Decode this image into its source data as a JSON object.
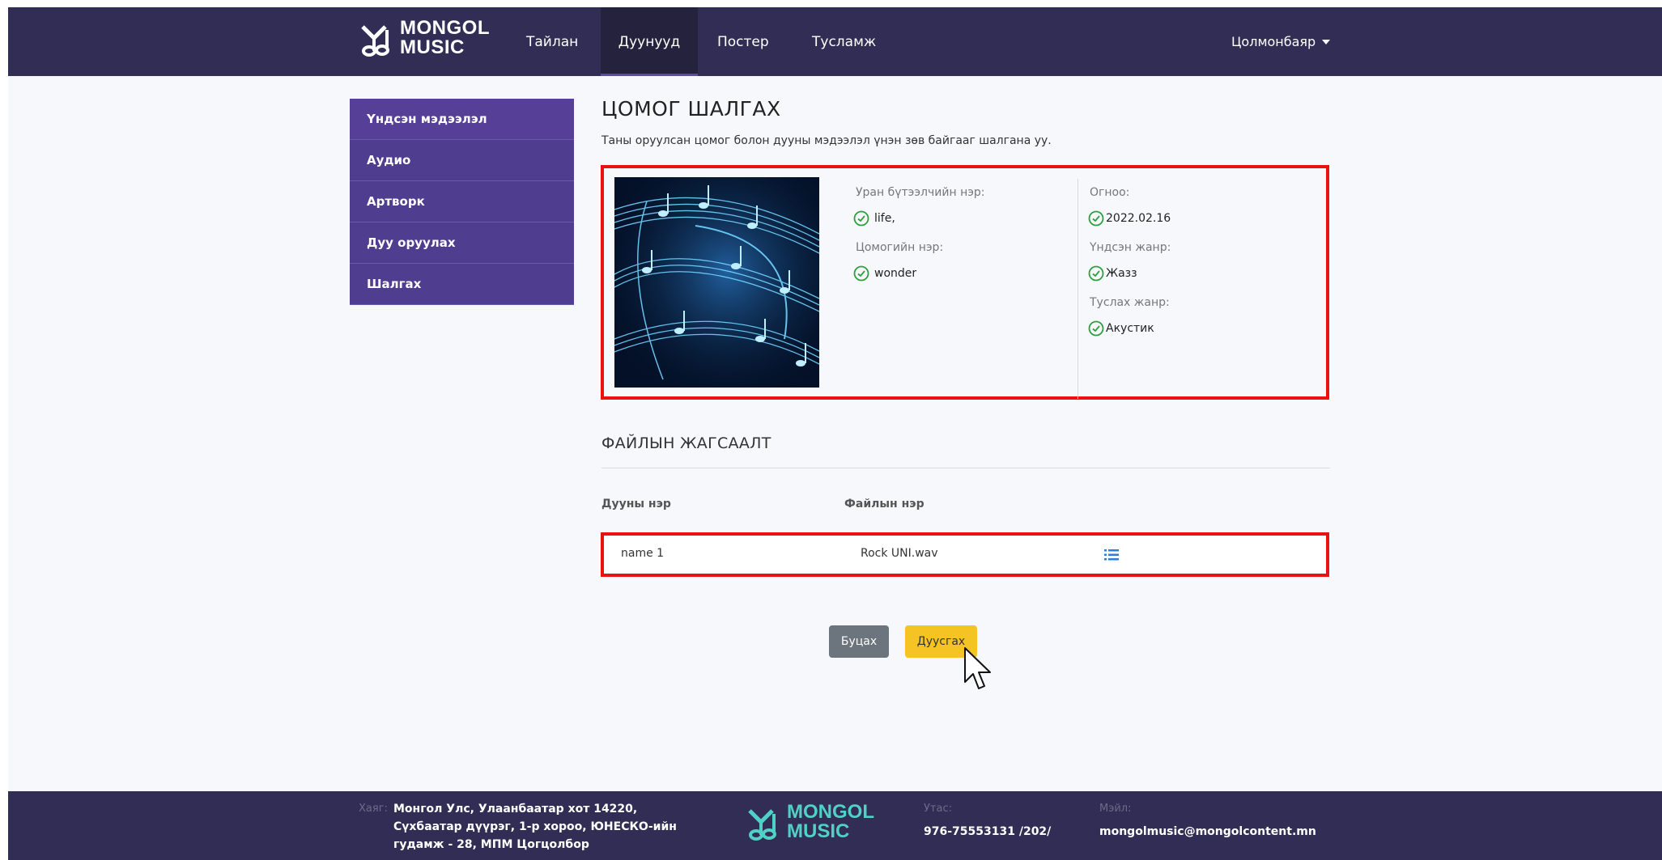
{
  "brand": {
    "line1": "MONGOL",
    "line2": "MUSIC"
  },
  "nav": {
    "items": [
      {
        "label": "Тайлан"
      },
      {
        "label": "Дуунууд"
      },
      {
        "label": "Постер"
      },
      {
        "label": "Тусламж"
      }
    ],
    "active": "Дуунууд",
    "user": "Цолмонбаяр"
  },
  "sidebar": {
    "items": [
      {
        "label": "Үндсэн мэдээлэл"
      },
      {
        "label": "Аудио"
      },
      {
        "label": "Артворк"
      },
      {
        "label": "Дуу оруулах"
      },
      {
        "label": "Шалгах"
      }
    ]
  },
  "page": {
    "title": "ЦОМОГ ШАЛГАХ",
    "description": "Таны оруулсан цомог болон дууны мэдээлэл үнэн зөв байгааг шалгана уу."
  },
  "album": {
    "artist_label": "Уран бүтээлчийн нэр:",
    "artist_value": "life,",
    "album_label": "Цомогийн нэр:",
    "album_value": "wonder",
    "date_label": "Огноо:",
    "date_value": "2022.02.16",
    "genre_label": "Үндсэн жанр:",
    "genre_value": "Жазз",
    "subgenre_label": "Туслах жанр:",
    "subgenre_value": "Акустик"
  },
  "files": {
    "title": "ФАЙЛЫН ЖАГСААЛТ",
    "headers": [
      "Дууны нэр",
      "Файлын нэр"
    ],
    "rows": [
      {
        "song": "name 1",
        "file": "Rock UNI.wav"
      }
    ]
  },
  "buttons": {
    "back": "Буцах",
    "finish": "Дуусгах"
  },
  "footer": {
    "address_label": "Хаяг:",
    "address_lines": [
      "Монгол Улс, Улаанбаатар хот 14220,",
      "Сүхбаатар дүүрэг, 1-р хороо, ЮНЕСКО-ийн",
      "гудамж - 28, МПМ Цогцолбор"
    ],
    "phone_label": "Утас:",
    "phone": "976-75553131 /202/",
    "email_label": "Мэйл:",
    "email": "mongolmusic@mongolcontent.mn"
  },
  "colors": {
    "navbar": "#322d55",
    "sidebar": "#4f3d8f",
    "highlight": "#ea1111",
    "check": "#2e9e3e",
    "primary_button": "#f6c324",
    "secondary_button": "#6c757d",
    "footer_logo": "#4fd1c5"
  },
  "icons": {
    "check": "check-circle-icon",
    "details": "list-icon",
    "caret": "caret-down-icon"
  }
}
